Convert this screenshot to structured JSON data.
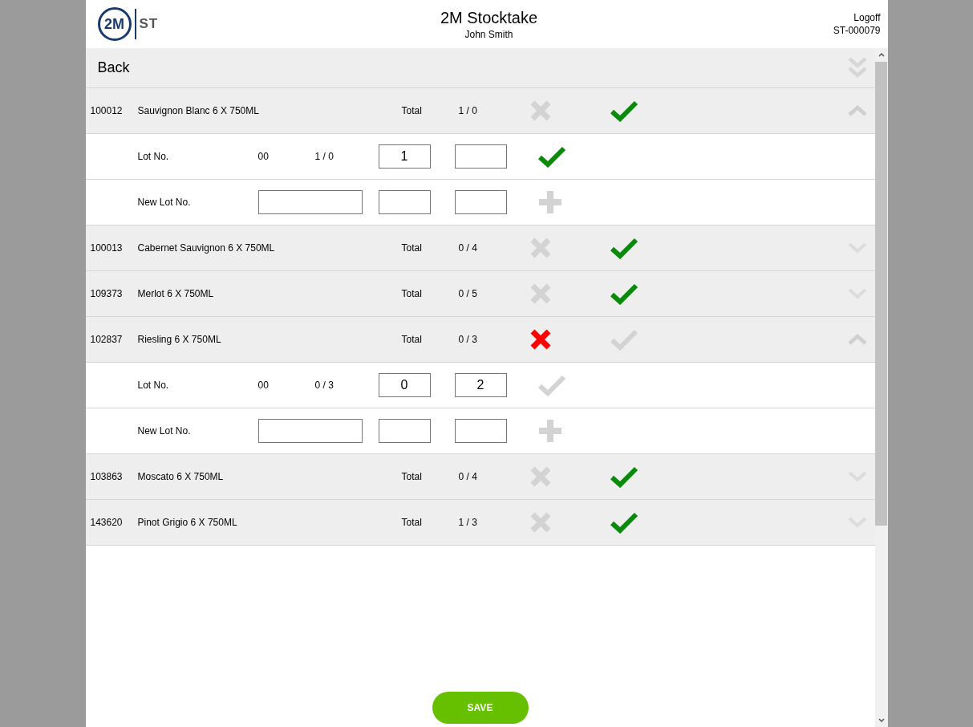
{
  "header": {
    "logo": {
      "mark": "2M",
      "suffix": "ST"
    },
    "title": "2M Stocktake",
    "user": "John Smith",
    "logoff": "Logoff",
    "stocktake_id": "ST-000079"
  },
  "back": {
    "label": "Back"
  },
  "products": [
    {
      "id": "100012",
      "name": "Sauvignon Blanc 6 X 750ML",
      "total_label": "Total",
      "count": "1 / 0",
      "rejected": false,
      "accepted": true,
      "expanded": true,
      "lots": [
        {
          "kind": "lot",
          "label": "Lot No.",
          "lot": "00",
          "count": "1 / 0",
          "counted": "1",
          "confirmed": true
        },
        {
          "kind": "new_lot",
          "label": "New Lot No."
        }
      ]
    },
    {
      "id": "100013",
      "name": "Cabernet Sauvignon 6 X 750ML",
      "total_label": "Total",
      "count": "0 / 4",
      "rejected": false,
      "accepted": true,
      "expanded": false
    },
    {
      "id": "109373",
      "name": "Merlot 6 X 750ML",
      "total_label": "Total",
      "count": "0 / 5",
      "rejected": false,
      "accepted": true,
      "expanded": false
    },
    {
      "id": "102837",
      "name": "Riesling 6 X 750ML",
      "total_label": "Total",
      "count": "0 / 3",
      "rejected": true,
      "accepted": false,
      "expanded": true,
      "lots": [
        {
          "kind": "lot",
          "label": "Lot No.",
          "lot": "00",
          "count": "0 / 3",
          "counted": "0",
          "adjust": "2",
          "confirmed": false
        },
        {
          "kind": "new_lot",
          "label": "New Lot No."
        }
      ]
    },
    {
      "id": "103863",
      "name": "Moscato 6 X 750ML",
      "total_label": "Total",
      "count": "0 / 4",
      "rejected": false,
      "accepted": true,
      "expanded": false
    },
    {
      "id": "143620",
      "name": "Pinot Grigio 6 X 750ML",
      "total_label": "Total",
      "count": "1 / 3",
      "rejected": false,
      "accepted": true,
      "expanded": false
    }
  ],
  "save": {
    "label": "SAVE"
  }
}
